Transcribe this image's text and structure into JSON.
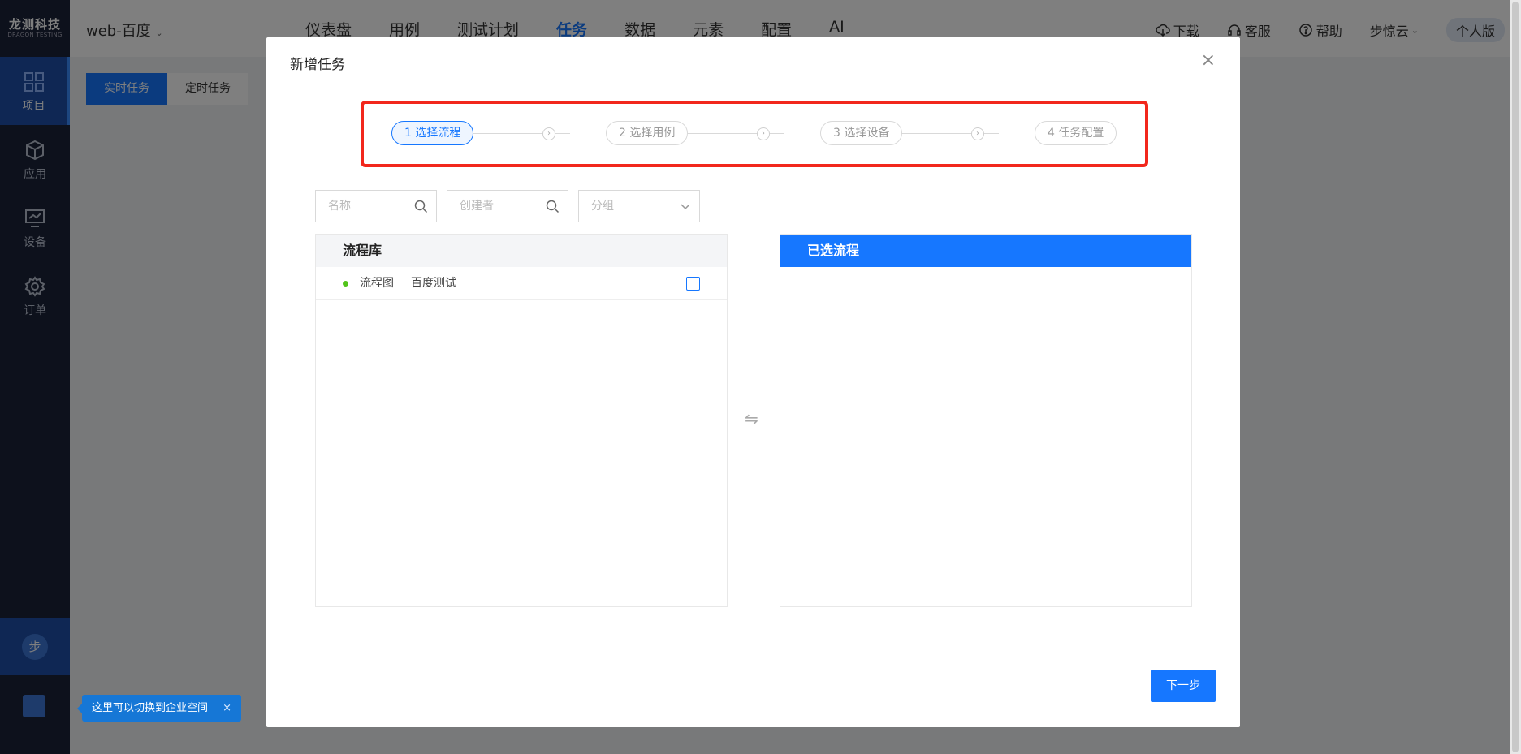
{
  "brand": {
    "name_cn": "龙测科技",
    "name_en": "DRAGON TESTING"
  },
  "sidebar": {
    "items": [
      {
        "label": "项目",
        "icon": "grid-icon",
        "active": true
      },
      {
        "label": "应用",
        "icon": "cube-icon",
        "active": false
      },
      {
        "label": "设备",
        "icon": "monitor-icon",
        "active": false
      },
      {
        "label": "订单",
        "icon": "gear-icon",
        "active": false
      }
    ],
    "avatar_text": "步",
    "tooltip": "这里可以切换到企业空间",
    "tooltip_close": "×"
  },
  "header": {
    "project": "web-百度",
    "menu": [
      "仪表盘",
      "用例",
      "测试计划",
      "任务",
      "数据",
      "元素",
      "配置",
      "AI"
    ],
    "active_menu": "任务",
    "tools": {
      "download": "下载",
      "service": "客服",
      "help": "帮助",
      "user": "步惊云"
    },
    "edition": "个人版"
  },
  "subtabs": [
    "实时任务",
    "定时任务"
  ],
  "modal": {
    "title": "新增任务",
    "close": "×",
    "steps": [
      "1 选择流程",
      "2 选择用例",
      "3 选择设备",
      "4 任务配置"
    ],
    "active_step": 0,
    "filters": {
      "name_placeholder": "名称",
      "creator_placeholder": "创建者",
      "group_placeholder": "分组"
    },
    "library": {
      "title": "流程库",
      "rows": [
        {
          "type": "流程图",
          "name": "百度测试",
          "status_color": "#52c41a",
          "checked": false
        }
      ]
    },
    "selected": {
      "title": "已选流程",
      "rows": []
    },
    "transfer_icon": "⇋",
    "next_button": "下一步"
  },
  "colors": {
    "primary": "#1677ff",
    "highlight": "#f2271c",
    "sidebar": "#1a2238"
  }
}
